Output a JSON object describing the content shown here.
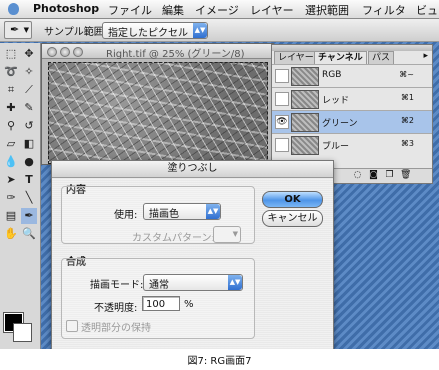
{
  "menubar": {
    "app": "Photoshop",
    "items": [
      "ファイル",
      "編集",
      "イメージ",
      "レイヤー",
      "選択範囲",
      "フィルタ",
      "ビュ"
    ]
  },
  "options_bar": {
    "sample_label": "サンプル範囲:",
    "sample_value": "指定したピクセル"
  },
  "document": {
    "title": "Right.tif @ 25% (グリーン/8)"
  },
  "panel": {
    "tabs": [
      "レイヤー",
      "チャンネル",
      "パス"
    ],
    "active_tab": "チャンネル",
    "channels": [
      {
        "name": "RGB",
        "shortcut": "⌘~",
        "visible": false,
        "selected": false
      },
      {
        "name": "レッド",
        "shortcut": "⌘1",
        "visible": false,
        "selected": false
      },
      {
        "name": "グリーン",
        "shortcut": "⌘2",
        "visible": true,
        "selected": true
      },
      {
        "name": "ブルー",
        "shortcut": "⌘3",
        "visible": false,
        "selected": false
      }
    ]
  },
  "dialog": {
    "title": "塗りつぶし",
    "contents_group": "内容",
    "use_label": "使用:",
    "use_value": "描画色",
    "custom_pattern_label": "カスタムパターン:",
    "blending_group": "合成",
    "mode_label": "描画モード:",
    "mode_value": "通常",
    "opacity_label": "不透明度:",
    "opacity_value": "100",
    "opacity_unit": "%",
    "preserve_transparency_label": "透明部分の保持",
    "ok_label": "OK",
    "cancel_label": "キャンセル"
  },
  "caption": "図7: RG画面7",
  "colors": {
    "foreground": "#000000",
    "background": "#ffffff",
    "accent": "#4f95e8",
    "selection": "#a8c4ea"
  }
}
